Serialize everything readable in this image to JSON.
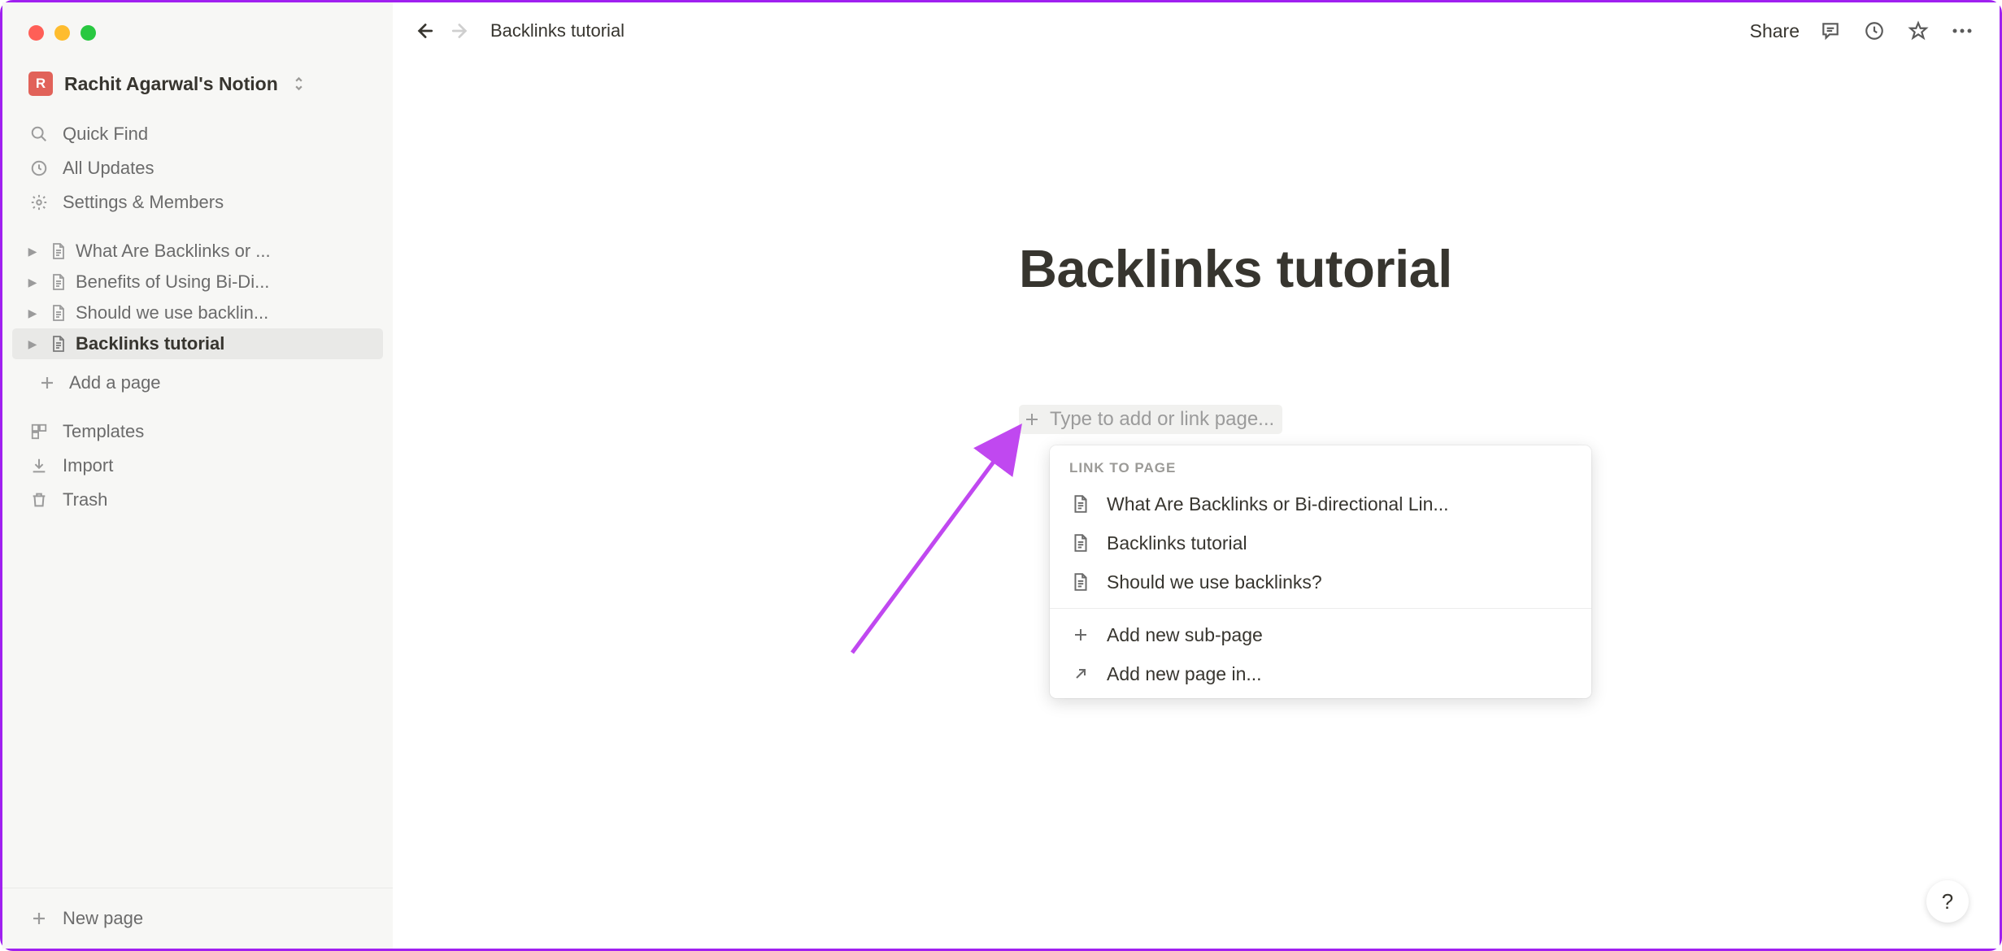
{
  "workspace": {
    "badge_letter": "R",
    "name": "Rachit Agarwal's Notion"
  },
  "sidebar": {
    "quickfind": "Quick Find",
    "updates": "All Updates",
    "settings": "Settings & Members",
    "pages": [
      "What Are Backlinks or ...",
      "Benefits of Using Bi-Di...",
      "Should we use backlin...",
      "Backlinks tutorial"
    ],
    "add_page": "Add a page",
    "templates": "Templates",
    "import": "Import",
    "trash": "Trash",
    "new_page": "New page"
  },
  "topbar": {
    "breadcrumb": "Backlinks tutorial",
    "share": "Share"
  },
  "page": {
    "title": "Backlinks tutorial",
    "placeholder": "Type to add or link page..."
  },
  "popup": {
    "header": "LINK TO PAGE",
    "items": [
      "What Are Backlinks or Bi-directional Lin...",
      "Backlinks tutorial",
      "Should we use backlinks?"
    ],
    "add_sub": "Add new sub-page",
    "add_in": "Add new page in..."
  },
  "help": "?"
}
